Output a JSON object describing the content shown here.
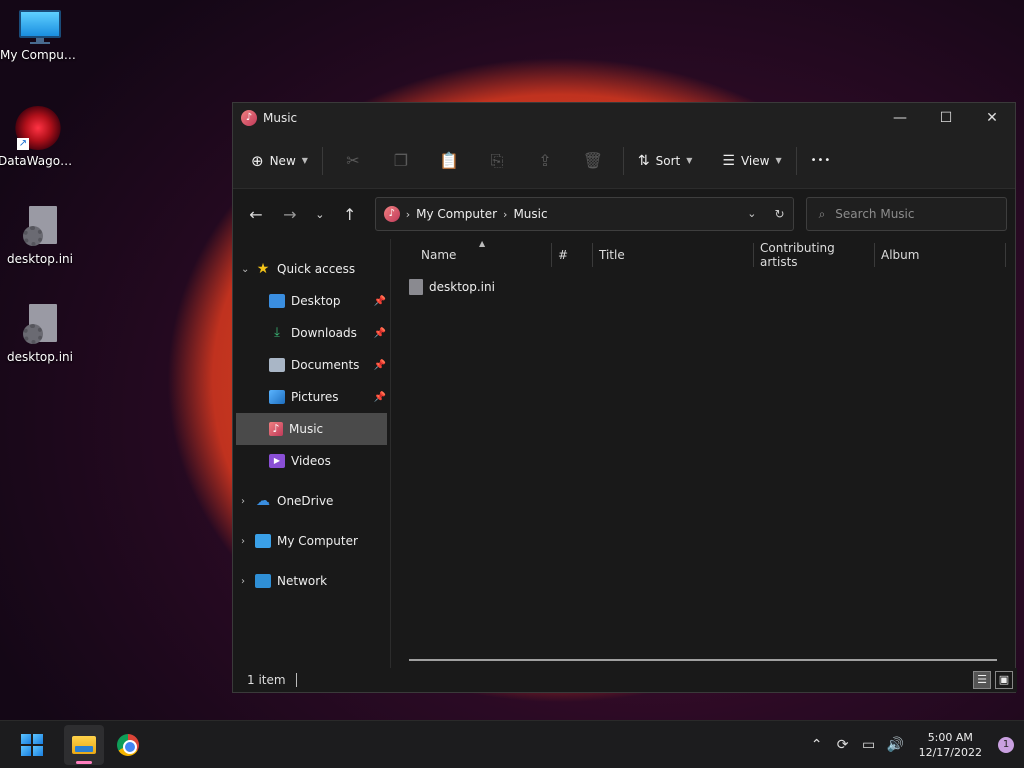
{
  "desktop": {
    "icons": [
      {
        "label": "My Computer"
      },
      {
        "label": "DataWagon..."
      },
      {
        "label": "desktop.ini"
      },
      {
        "label": "desktop.ini"
      }
    ]
  },
  "window": {
    "title": "Music",
    "controls": {
      "minimize": "—",
      "maximize": "☐",
      "close": "✕"
    }
  },
  "toolbar": {
    "new_label": "New",
    "sort_label": "Sort",
    "view_label": "View",
    "more_label": "•••"
  },
  "address": {
    "crumbs": [
      "My Computer",
      "Music"
    ],
    "search_placeholder": "Search Music"
  },
  "navpane": {
    "quick_access": "Quick access",
    "pinned": [
      "Desktop",
      "Downloads",
      "Documents",
      "Pictures"
    ],
    "others": [
      "Music",
      "Videos"
    ],
    "onedrive": "OneDrive",
    "my_computer": "My Computer",
    "network": "Network",
    "selected": "Music"
  },
  "columns": [
    "Name",
    "#",
    "Title",
    "Contributing artists",
    "Album"
  ],
  "files": [
    {
      "name": "desktop.ini"
    }
  ],
  "status": {
    "count": "1 item"
  },
  "taskbar": {
    "time": "5:00 AM",
    "date": "12/17/2022",
    "notifications": "1"
  }
}
